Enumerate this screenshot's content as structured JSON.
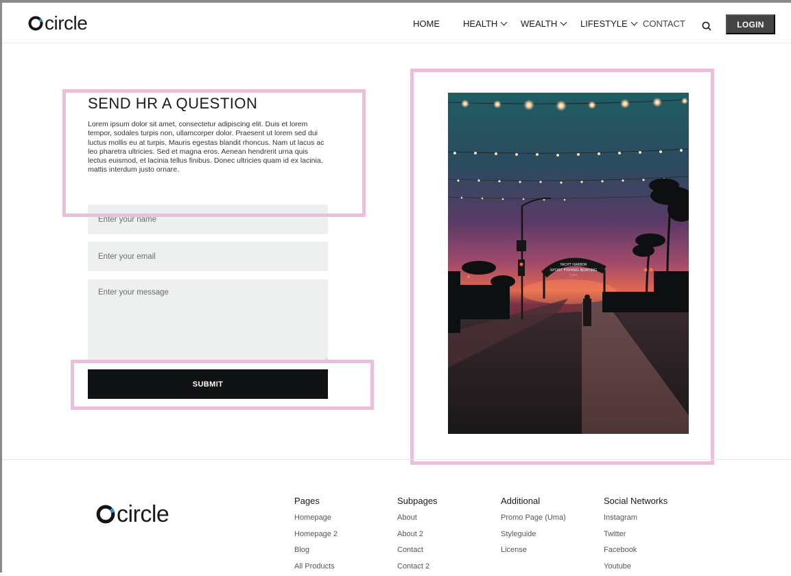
{
  "brand": {
    "name": "circle"
  },
  "nav": {
    "items": [
      {
        "label": "HOME",
        "has_dropdown": false,
        "active": false
      },
      {
        "label": "HEALTH",
        "has_dropdown": true,
        "active": false
      },
      {
        "label": "WEALTH",
        "has_dropdown": true,
        "active": false
      },
      {
        "label": "LIFESTYLE",
        "has_dropdown": true,
        "active": false
      },
      {
        "label": "CONTACT",
        "has_dropdown": false,
        "active": true
      }
    ],
    "search_icon": "search-icon",
    "login_label": "LOGIN"
  },
  "form": {
    "heading": "SEND HR A QUESTION",
    "intro": "Lorem ipsum dolor sit amet, consectetur adipiscing elit. Duis et lorem tempor, sodales turpis non, ullamcorper dolor. Praesent ut lorem sed dui luctus mollis eu at turpis. Mauris egestas blandit rhoncus. Nam ut lacus ac leo pharetra ultricies. Sed et magna eros. Aenean hendrerit urna quis lectus euismod, et lacinia tellus finibus. Donec ultricies quam id ex lacinia, mattis interdum justo ornare.",
    "name_placeholder": "Enter your name",
    "email_placeholder": "Enter your email",
    "message_placeholder": "Enter your message",
    "submit_label": "SUBMIT"
  },
  "photo": {
    "sign_line1": "YACHT HARBOR",
    "sign_line2": "SPORT FISHING BOATING",
    "sign_line3": "Cafes"
  },
  "footer": {
    "columns": [
      {
        "title": "Pages",
        "links": [
          "Homepage",
          "Homepage 2",
          "Blog",
          "All Products"
        ]
      },
      {
        "title": "Subpages",
        "links": [
          "About",
          "About 2",
          "Contact",
          "Contact 2"
        ]
      },
      {
        "title": "Additional",
        "links": [
          "Promo Page (Uma)",
          "Styleguide",
          "License"
        ]
      },
      {
        "title": "Social Networks",
        "links": [
          "Instagram",
          "Twitter",
          "Facebook",
          "Youtube"
        ]
      }
    ]
  },
  "colors": {
    "accent_dark": "#111214",
    "login_bg": "#444444",
    "field_bg": "#eef0f0",
    "annotation": "#e9bfda"
  }
}
